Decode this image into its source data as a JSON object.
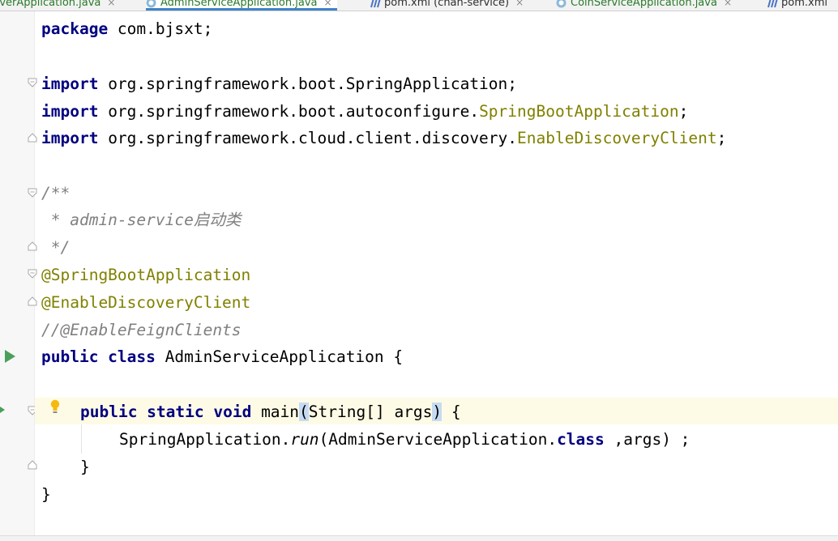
{
  "tabs": [
    {
      "label": "rverApplication.java",
      "kind": "java",
      "active": false
    },
    {
      "label": "AdminServiceApplication.java",
      "kind": "java",
      "active": true
    },
    {
      "label": "pom.xml (chan-service)",
      "kind": "maven",
      "active": false
    },
    {
      "label": "CoinServiceApplication.java",
      "kind": "java",
      "active": false
    },
    {
      "label": "pom.xml",
      "kind": "maven",
      "active": false
    }
  ],
  "tab_close_glyph": "×",
  "code": {
    "l1": {
      "kw": "package",
      "rest": " com.bjsxt;"
    },
    "l2": {
      "kw": "import",
      "rest": " org.springframework.boot.SpringApplication;"
    },
    "l3": {
      "kw": "import",
      "pre": " org.springframework.boot.autoconfigure.",
      "ann": "SpringBootApplication",
      "post": ";"
    },
    "l4": {
      "kw": "import",
      "pre": " org.springframework.cloud.client.discovery.",
      "ann": "EnableDiscoveryClient",
      "post": ";"
    },
    "c1": "/**",
    "c2": " * admin-service启动类",
    "c3": " */",
    "a1": "@SpringBootApplication",
    "a2": "@EnableDiscoveryClient",
    "c4": "//@EnableFeignClients",
    "cls": {
      "kw": "public class",
      "rest": " AdminServiceApplication {"
    },
    "main": {
      "kw": "public static void",
      "name": " main",
      "open": "(",
      "params": "String[] args",
      "close": ")",
      "rest": " {"
    },
    "body": {
      "pre": "SpringApplication.",
      "method": "run",
      "open": "(AdminServiceApplication.",
      "kw": "class",
      "post": " ,args) ;"
    },
    "end1": "}",
    "end2": "}"
  },
  "colors": {
    "keyword": "#000080",
    "annotation": "#808000",
    "comment": "#808080",
    "run": "#4aa05a",
    "caret_line": "#fdfbe6"
  }
}
